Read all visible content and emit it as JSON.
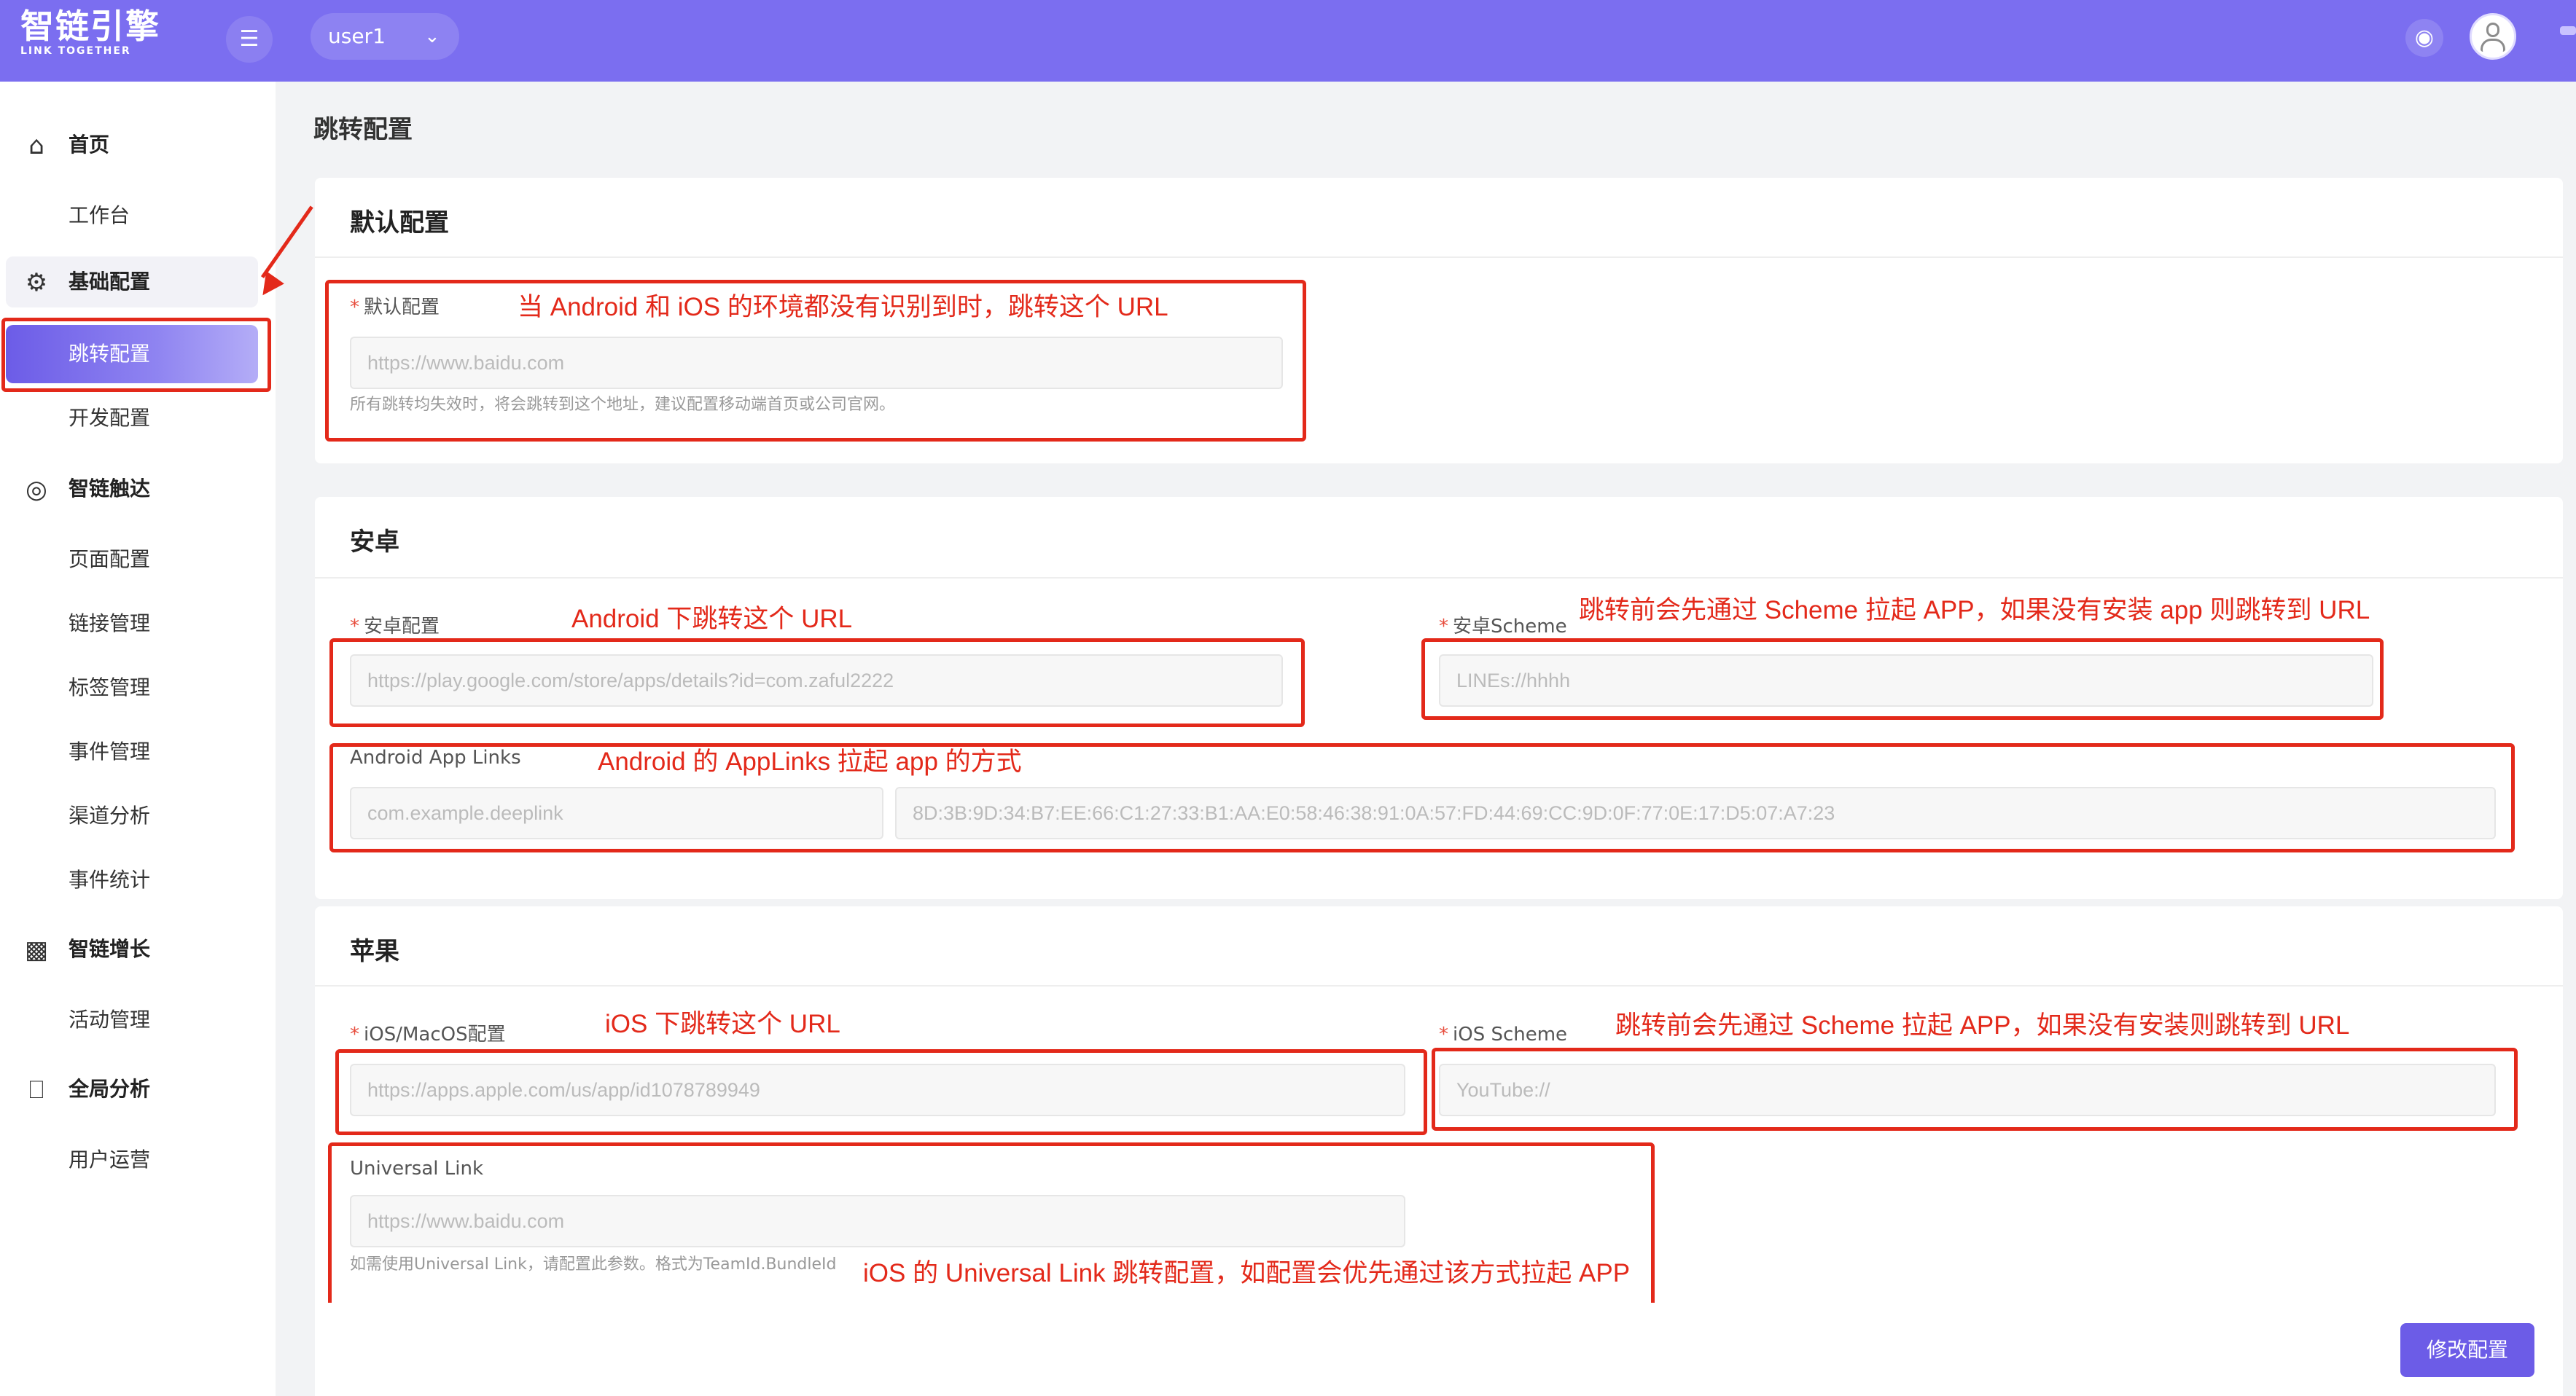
{
  "header": {
    "logo_cn": "智链引擎",
    "logo_en": "LINK TOGETHER",
    "menu_toggle_icon": "menu-fold-icon",
    "user_select_value": "user1",
    "bar_color": "#7b6ef0"
  },
  "sidebar": {
    "home": "首页",
    "workbench": "工作台",
    "basic_config": "基础配置",
    "redirect_config": "跳转配置",
    "dev_config": "开发配置",
    "smart_reach": "智链触达",
    "page_config": "页面配置",
    "link_mgmt": "链接管理",
    "tag_mgmt": "标签管理",
    "event_mgmt": "事件管理",
    "channel_analysis": "渠道分析",
    "event_stats": "事件统计",
    "smart_growth": "智链增长",
    "activity_mgmt": "活动管理",
    "global_analysis": "全局分析",
    "user_ops": "用户运营",
    "active_color": "#6c5ce7"
  },
  "page": {
    "title": "跳转配置"
  },
  "default_section": {
    "title": "默认配置",
    "field_label": "默认配置",
    "placeholder": "https://www.baidu.com",
    "help": "所有跳转均失效时，将会跳转到这个地址，建议配置移动端首页或公司官网。"
  },
  "android_section": {
    "title": "安卓",
    "config_label": "安卓配置",
    "config_placeholder": "https://play.google.com/store/apps/details?id=com.zaful2222",
    "scheme_label": "安卓Scheme",
    "scheme_placeholder": "LINEs://hhhh",
    "applinks_label": "Android App Links",
    "applinks_package_placeholder": "com.example.deeplink",
    "applinks_fingerprint_placeholder": "8D:3B:9D:34:B7:EE:66:C1:27:33:B1:AA:E0:58:46:38:91:0A:57:FD:44:69:CC:9D:0F:77:0E:17:D5:07:A7:23"
  },
  "ios_section": {
    "title": "苹果",
    "config_label": "iOS/MacOS配置",
    "config_placeholder": "https://apps.apple.com/us/app/id1078789949",
    "scheme_label": "iOS Scheme",
    "scheme_placeholder": "YouTube://",
    "universal_label": "Universal Link",
    "universal_placeholder": "https://www.baidu.com",
    "universal_help": "如需使用Universal Link，请配置此参数。格式为TeamId.BundleId"
  },
  "annotations": {
    "default_url": "当 Android 和 iOS 的环境都没有识别到时，跳转这个 URL",
    "android_url": "Android 下跳转这个 URL",
    "android_scheme": "跳转前会先通过 Scheme 拉起 APP，如果没有安装 app 则跳转到 URL",
    "android_applinks": "Android 的 AppLinks 拉起 app 的方式",
    "ios_url": "iOS 下跳转这个 URL",
    "ios_scheme": "跳转前会先通过 Scheme 拉起 APP，如果没有安装则跳转到 URL",
    "ios_universal": "iOS 的 Universal Link 跳转配置，如配置会优先通过该方式拉起 APP",
    "annotation_color": "#e3291a"
  },
  "actions": {
    "submit_label": "修改配置"
  }
}
